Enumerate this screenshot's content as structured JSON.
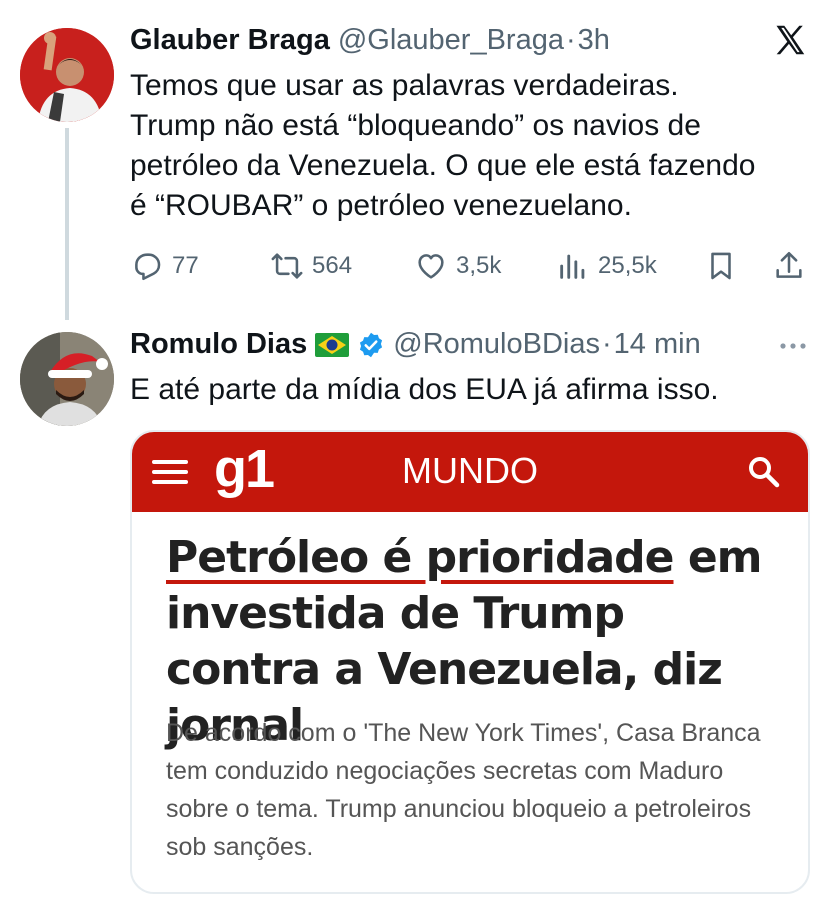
{
  "tweet1": {
    "name": "Glauber Braga",
    "handle": "@Glauber_Braga",
    "separator": "·",
    "time": "3h",
    "text_line1": "Temos que usar as palavras verdadeiras.",
    "text_line2": "Trump não está “bloqueando” os navios de",
    "text_line3": "petróleo da Venezuela. O que ele está fazendo",
    "text_line4": "é “ROUBAR” o petróleo venezuelano.",
    "replies": "77",
    "retweets": "564",
    "likes": "3,5k",
    "views": "25,5k"
  },
  "tweet2": {
    "name": "Romulo Dias",
    "handle": "@RomuloBDias",
    "separator": "·",
    "time": "14 min",
    "text": "E até parte da mídia dos EUA já afirma isso."
  },
  "card": {
    "logo": "g1",
    "section": "MUNDO",
    "headline_highlight": "Petróleo é prioridade",
    "headline_rest": " em investida de Trump contra a Venezuela, diz jornal",
    "summary": "De acordo com o 'The New York Times', Casa Branca tem conduzido negociações secretas com Maduro sobre o tema. Trump anunciou bloqueio a petroleiros sob sanções."
  },
  "icons": {
    "x_logo": "x-logo-icon",
    "reply": "reply-icon",
    "retweet": "retweet-icon",
    "like": "heart-icon",
    "views": "views-icon",
    "bookmark": "bookmark-icon",
    "share": "share-icon",
    "more": "more-icon",
    "flag": "brazil-flag-icon",
    "verified": "verified-icon"
  },
  "colors": {
    "text": "#0f1419",
    "muted": "#536471",
    "g1_red": "#c4170c",
    "verified_blue": "#1d9bf0"
  }
}
